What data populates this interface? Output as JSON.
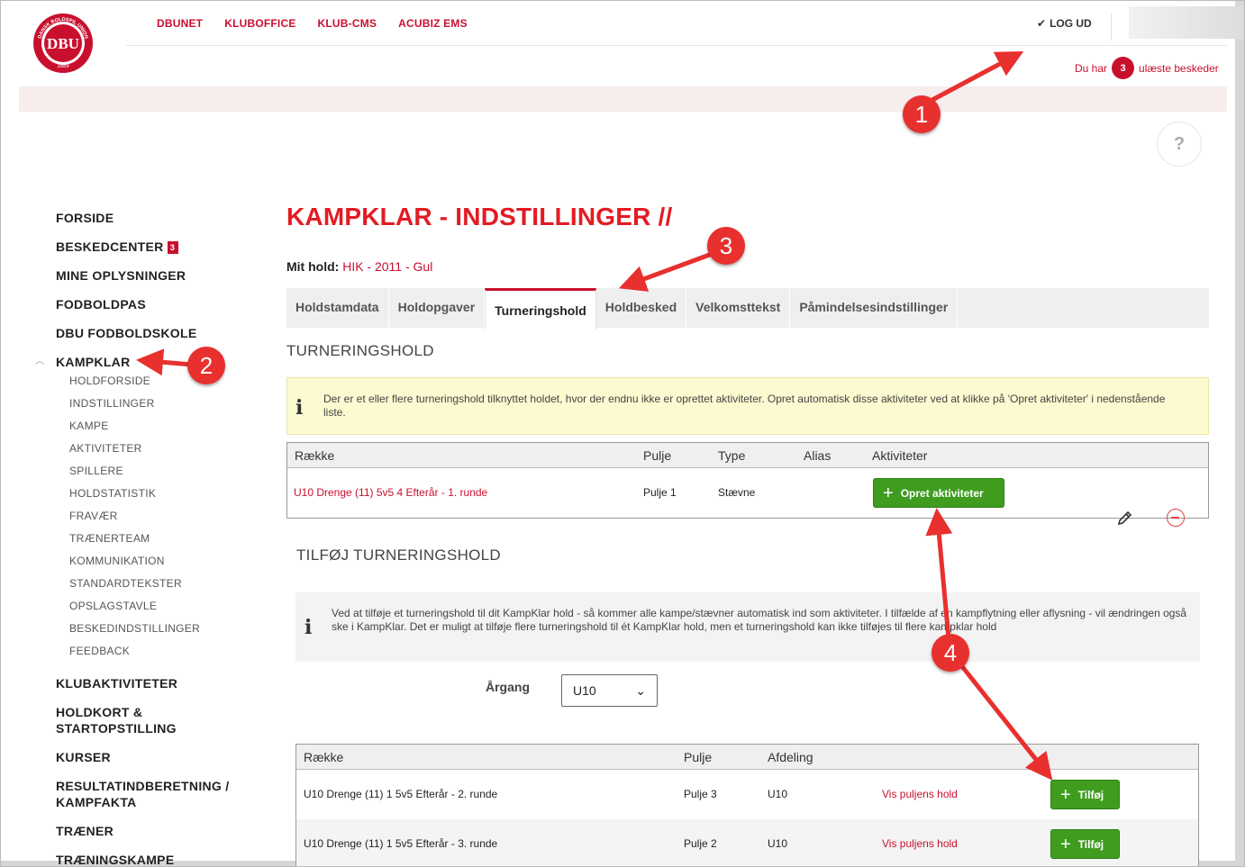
{
  "header": {
    "logo_text": "DBU",
    "logo_ring": "DANSK BOLDSPIL UNION",
    "logo_year": "1889",
    "nav": [
      "DBUNET",
      "KLUBOFFICE",
      "KLUB-CMS",
      "ACUBIZ EMS"
    ],
    "logout": "LOG UD",
    "unread_prefix": "Du har",
    "unread_count": "3",
    "unread_suffix": "ulæste beskeder",
    "help": "?"
  },
  "sidebar": {
    "items": [
      {
        "label": "FORSIDE"
      },
      {
        "label": "BESKEDCENTER",
        "badge": "3"
      },
      {
        "label": "MINE OPLYSNINGER"
      },
      {
        "label": "FODBOLDPAS"
      },
      {
        "label": "DBU FODBOLDSKOLE"
      },
      {
        "label": "KAMPKLAR"
      }
    ],
    "subitems": [
      "HOLDFORSIDE",
      "INDSTILLINGER",
      "KAMPE",
      "AKTIVITETER",
      "SPILLERE",
      "HOLDSTATISTIK",
      "FRAVÆR",
      "TRÆNERTEAM",
      "KOMMUNIKATION",
      "STANDARDTEKSTER",
      "OPSLAGSTAVLE",
      "BESKEDINDSTILLINGER",
      "FEEDBACK"
    ],
    "items_after": [
      {
        "label": "KLUBAKTIVITETER"
      },
      {
        "label": "HOLDKORT & STARTOPSTILLING"
      },
      {
        "label": "KURSER"
      },
      {
        "label": "RESULTATINDBERETNING / KAMPFAKTA"
      },
      {
        "label": "TRÆNER"
      },
      {
        "label": "TRÆNINGSKAMPE"
      }
    ]
  },
  "main": {
    "title": "KAMPKLAR - INDSTILLINGER //",
    "mithold_label": "Mit hold:",
    "mithold_value": "HIK - 2011 - Gul",
    "tabs": [
      "Holdstamdata",
      "Holdopgaver",
      "Turneringshold",
      "Holdbesked",
      "Velkomsttekst",
      "Påmindelsesindstillinger"
    ],
    "active_tab": "Turneringshold",
    "section1_title": "TURNERINGSHOLD",
    "info1": "Der er et eller flere turneringshold tilknyttet holdet, hvor der endnu ikke er oprettet aktiviteter. Opret automatisk disse aktiviteter ved at klikke på 'Opret aktiviteter' i nedenstående liste.",
    "table1": {
      "headers": [
        "Række",
        "Pulje",
        "Type",
        "Alias",
        "Aktiviteter"
      ],
      "rows": [
        {
          "raekke": "U10 Drenge (11) 5v5 4 Efterår - 1. runde",
          "pulje": "Pulje 1",
          "type": "Stævne",
          "alias": "",
          "action": "Opret aktiviteter"
        }
      ]
    },
    "section2_title": "TILFØJ TURNERINGSHOLD",
    "info2": "Ved at tilføje et turneringshold til dit KampKlar hold - så kommer alle kampe/stævner automatisk ind som aktiviteter. I tilfælde af en kampflytning eller aflysning - vil ændringen også ske i KampKlar. Det er muligt at tilføje flere turneringshold til ét KampKlar hold, men et turneringshold kan ikke tilføjes til flere kampklar hold",
    "aargang_label": "Årgang",
    "aargang_value": "U10",
    "table2": {
      "headers": [
        "Række",
        "Pulje",
        "Afdeling"
      ],
      "rows": [
        {
          "raekke": "U10 Drenge (11) 1 5v5 Efterår - 2. runde",
          "pulje": "Pulje 3",
          "afdeling": "U10",
          "link": "Vis puljens hold",
          "action": "Tilføj"
        },
        {
          "raekke": "U10 Drenge (11) 1 5v5 Efterår - 3. runde",
          "pulje": "Pulje 2",
          "afdeling": "U10",
          "link": "Vis puljens hold",
          "action": "Tilføj"
        }
      ]
    }
  },
  "annotations": [
    "1",
    "2",
    "3",
    "4"
  ],
  "colors": {
    "brand_red": "#c8102e",
    "title_red": "#e31b23",
    "green": "#3f9c1f",
    "callout": "#e8302e"
  }
}
